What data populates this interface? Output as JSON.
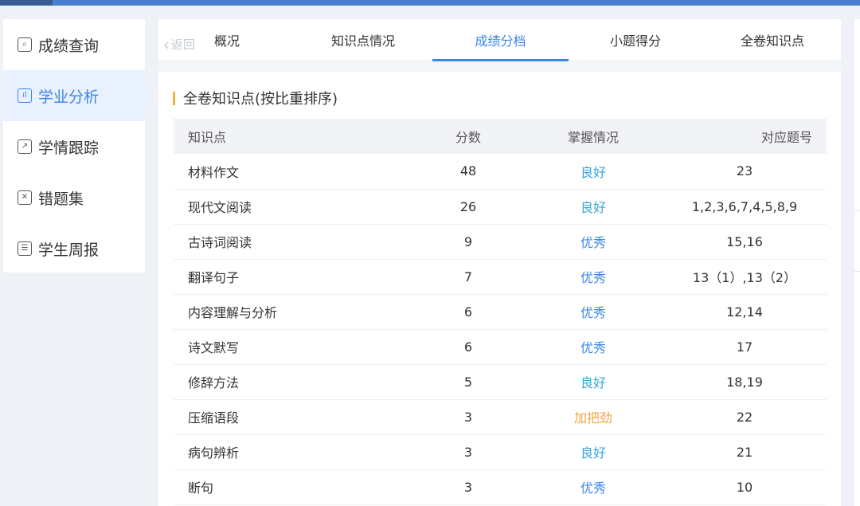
{
  "sidebar": {
    "items": [
      {
        "label": "成绩查询",
        "icon": "search-icon",
        "glyph": "⌕",
        "active": false
      },
      {
        "label": "学业分析",
        "icon": "bar-chart-icon",
        "glyph": "ıl",
        "active": true
      },
      {
        "label": "学情跟踪",
        "icon": "trend-icon",
        "glyph": "↗",
        "active": false
      },
      {
        "label": "错题集",
        "icon": "close-box-icon",
        "glyph": "✕",
        "active": false
      },
      {
        "label": "学生周报",
        "icon": "list-icon",
        "glyph": "☰",
        "active": false
      }
    ]
  },
  "tabs": {
    "back_label": "返回",
    "items": [
      {
        "label": "概况",
        "active": false
      },
      {
        "label": "知识点情况",
        "active": false
      },
      {
        "label": "成绩分档",
        "active": true
      },
      {
        "label": "小题得分",
        "active": false
      },
      {
        "label": "全卷知识点",
        "active": false
      }
    ]
  },
  "section": {
    "title": "全卷知识点(按比重排序)"
  },
  "table": {
    "headers": [
      "知识点",
      "分数",
      "掌握情况",
      "对应题号"
    ],
    "rows": [
      {
        "point": "材料作文",
        "score": "48",
        "status": "良好",
        "status_type": "good",
        "questions": "23"
      },
      {
        "point": "现代文阅读",
        "score": "26",
        "status": "良好",
        "status_type": "good",
        "questions": "1,2,3,6,7,4,5,8,9"
      },
      {
        "point": "古诗词阅读",
        "score": "9",
        "status": "优秀",
        "status_type": "excellent",
        "questions": "15,16"
      },
      {
        "point": "翻译句子",
        "score": "7",
        "status": "优秀",
        "status_type": "excellent",
        "questions": "13（1）,13（2）"
      },
      {
        "point": "内容理解与分析",
        "score": "6",
        "status": "优秀",
        "status_type": "excellent",
        "questions": "12,14"
      },
      {
        "point": "诗文默写",
        "score": "6",
        "status": "优秀",
        "status_type": "excellent",
        "questions": "17"
      },
      {
        "point": "修辞方法",
        "score": "5",
        "status": "良好",
        "status_type": "good",
        "questions": "18,19"
      },
      {
        "point": "压缩语段",
        "score": "3",
        "status": "加把劲",
        "status_type": "effort",
        "questions": "22"
      },
      {
        "point": "病句辨析",
        "score": "3",
        "status": "良好",
        "status_type": "good",
        "questions": "21"
      },
      {
        "point": "断句",
        "score": "3",
        "status": "优秀",
        "status_type": "excellent",
        "questions": "10"
      }
    ]
  },
  "colors": {
    "accent": "#3a86e8",
    "good": "#3aa7d9",
    "excellent": "#3a86e8",
    "effort": "#f0a33c",
    "section_marker": "#f3b637"
  }
}
